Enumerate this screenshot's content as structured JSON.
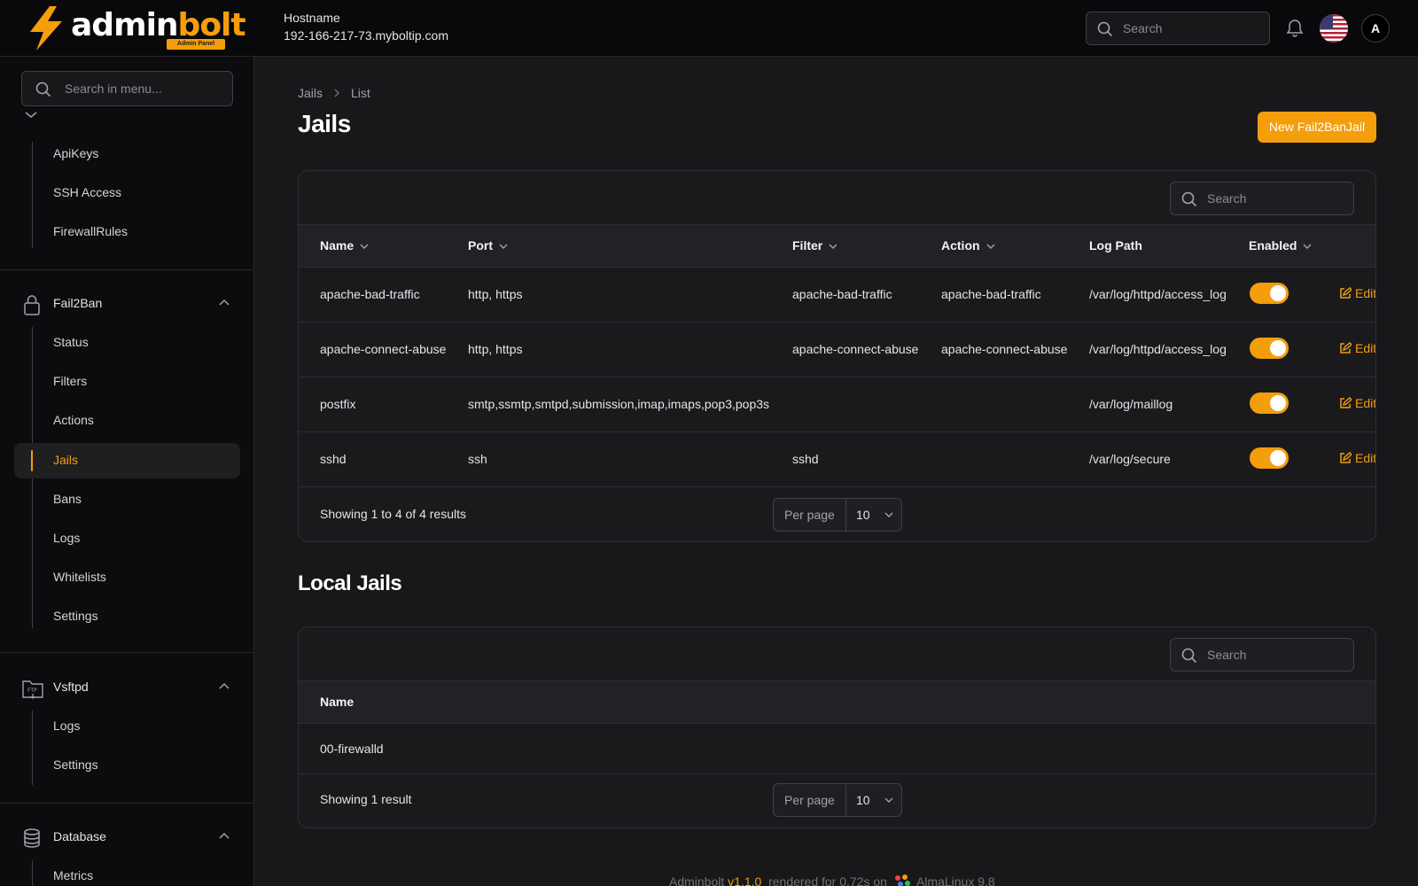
{
  "app": {
    "name_part1": "admin",
    "name_part2": "bolt",
    "badge": "Admin Panel"
  },
  "host": {
    "label": "Hostname",
    "value": "192-166-217-73.myboltip.com"
  },
  "topbar": {
    "search_placeholder": "Search",
    "avatar_initial": "A"
  },
  "sidebar": {
    "search_placeholder": "Search in menu...",
    "top_items": [
      "ApiKeys",
      "SSH Access",
      "FirewallRules"
    ],
    "groups": [
      {
        "label": "Fail2Ban",
        "items": [
          "Status",
          "Filters",
          "Actions",
          "Jails",
          "Bans",
          "Logs",
          "Whitelists",
          "Settings"
        ],
        "active": "Jails"
      },
      {
        "label": "Vsftpd",
        "items": [
          "Logs",
          "Settings"
        ]
      },
      {
        "label": "Database",
        "items": [
          "Metrics"
        ]
      }
    ]
  },
  "breadcrumb": [
    "Jails",
    "List"
  ],
  "page_title": "Jails",
  "new_button": "New Fail2BanJail",
  "jails_table": {
    "search_placeholder": "Search",
    "columns": [
      "Name",
      "Port",
      "Filter",
      "Action",
      "Log Path",
      "Enabled"
    ],
    "rows": [
      {
        "name": "apache-bad-traffic",
        "port": "http, https",
        "filter": "apache-bad-traffic",
        "action": "apache-bad-traffic",
        "log_path": "/var/log/httpd/access_log",
        "enabled": true
      },
      {
        "name": "apache-connect-abuse",
        "port": "http, https",
        "filter": "apache-connect-abuse",
        "action": "apache-connect-abuse",
        "log_path": "/var/log/httpd/access_log",
        "enabled": true
      },
      {
        "name": "postfix",
        "port": "smtp,ssmtp,smtpd,submission,imap,imaps,pop3,pop3s",
        "filter": "",
        "action": "",
        "log_path": "/var/log/maillog",
        "enabled": true
      },
      {
        "name": "sshd",
        "port": "ssh",
        "filter": "sshd",
        "action": "",
        "log_path": "/var/log/secure",
        "enabled": true
      }
    ],
    "edit_label": "Edit",
    "showing": "Showing 1 to 4 of 4 results",
    "per_page_label": "Per page",
    "per_page_value": "10"
  },
  "local_jails": {
    "title": "Local Jails",
    "search_placeholder": "Search",
    "column": "Name",
    "rows": [
      "00-firewalld"
    ],
    "showing": "Showing 1 result",
    "per_page_label": "Per page",
    "per_page_value": "10"
  },
  "footer": {
    "app": "Adminbolt",
    "version": "v1.1.0",
    "rendered": "rendered for 0.72s on",
    "os": "AlmaLinux 9.8"
  },
  "colors": {
    "accent": "#f59e0b",
    "background": "#18181b",
    "sidebar": "#0c0c0e"
  }
}
